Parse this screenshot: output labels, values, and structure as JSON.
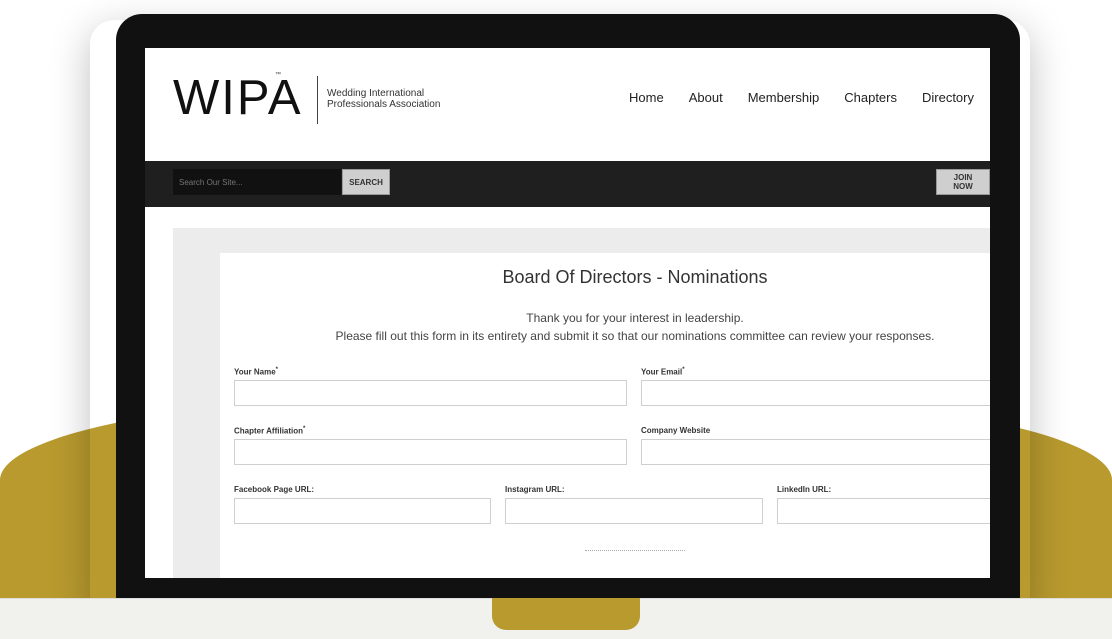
{
  "header": {
    "logo": "WIPA",
    "logo_tm": "™",
    "logo_sub": "Wedding International Professionals Association",
    "nav": [
      "Home",
      "About",
      "Membership",
      "Chapters",
      "Directory"
    ]
  },
  "search": {
    "placeholder": "Search Our Site...",
    "button": "SEARCH",
    "join": "JOIN NOW"
  },
  "form": {
    "title": "Board Of Directors - Nominations",
    "intro1": "Thank you for your interest in leadership.",
    "intro2": "Please fill out this form in its entirety and submit it so that our nominations committee can review your responses.",
    "fields": {
      "name": "Your Name",
      "email": "Your Email",
      "chapter": "Chapter Affiliation",
      "website": "Company Website",
      "facebook": "Facebook Page URL:",
      "instagram": "Instagram URL:",
      "linkedin": "LinkedIn URL:"
    },
    "required": "*"
  },
  "colors": {
    "gold": "#b89a2e",
    "bar": "#1f1f1f"
  }
}
